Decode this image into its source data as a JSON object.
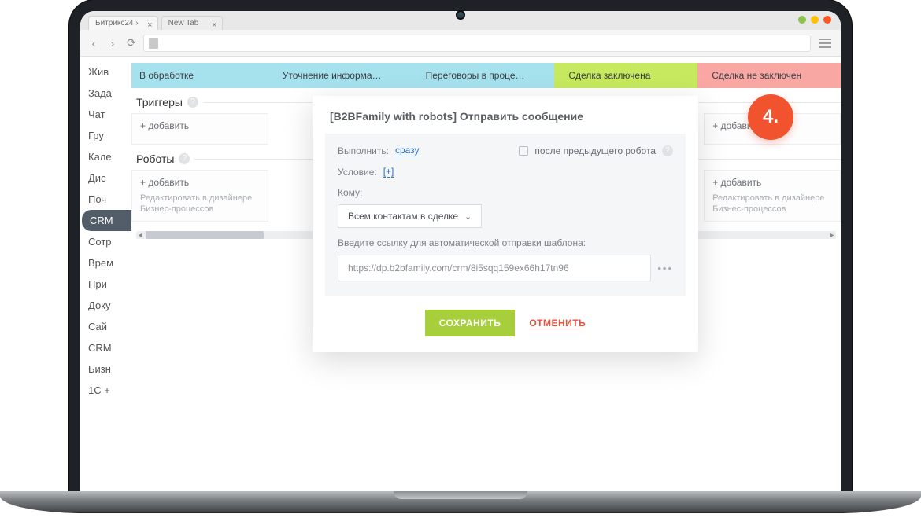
{
  "browser": {
    "tabs": [
      {
        "title": "Битрикс24 ›"
      },
      {
        "title": "New Tab"
      }
    ]
  },
  "step_badge": "4.",
  "sidebar": {
    "items": [
      {
        "label": "Жив"
      },
      {
        "label": "Зада"
      },
      {
        "label": "Чат"
      },
      {
        "label": "Гру"
      },
      {
        "label": "Кале"
      },
      {
        "label": "Дис"
      },
      {
        "label": "Поч"
      },
      {
        "label": "CRM",
        "active": true
      },
      {
        "label": "Сотр"
      },
      {
        "label": "Врем"
      },
      {
        "label": "При"
      },
      {
        "label": "Доку"
      },
      {
        "label": "Сай"
      },
      {
        "label": "CRM"
      },
      {
        "label": "Бизн"
      },
      {
        "label": "1C +"
      }
    ]
  },
  "stages": [
    {
      "label": "В обработке",
      "color": "blue"
    },
    {
      "label": "Уточнение информа…",
      "color": "blue"
    },
    {
      "label": "Переговоры в проце…",
      "color": "blue"
    },
    {
      "label": "Сделка заключена",
      "color": "green"
    },
    {
      "label": "Сделка не заключен",
      "color": "red"
    }
  ],
  "sections": {
    "triggers_title": "Триггеры",
    "robots_title": "Роботы",
    "add_label": "+ добавить",
    "designer_note": "Редактировать в дизайнере Бизнес-процессов"
  },
  "modal": {
    "title": "[B2BFamily with robots] Отправить сообщение",
    "execute_label": "Выполнить:",
    "execute_value": "сразу",
    "after_prev_label": "после предыдущего робота",
    "condition_label": "Условие:",
    "condition_value": "[+]",
    "to_label": "Кому:",
    "to_select": "Всем контактам в сделке",
    "link_prompt": "Введите ссылку для автоматической отправки шаблона:",
    "link_value": "https://dp.b2bfamily.com/crm/8i5sqq159ex66h17tn96",
    "save": "СОХРАНИТЬ",
    "cancel": "ОТМЕНИТЬ"
  }
}
